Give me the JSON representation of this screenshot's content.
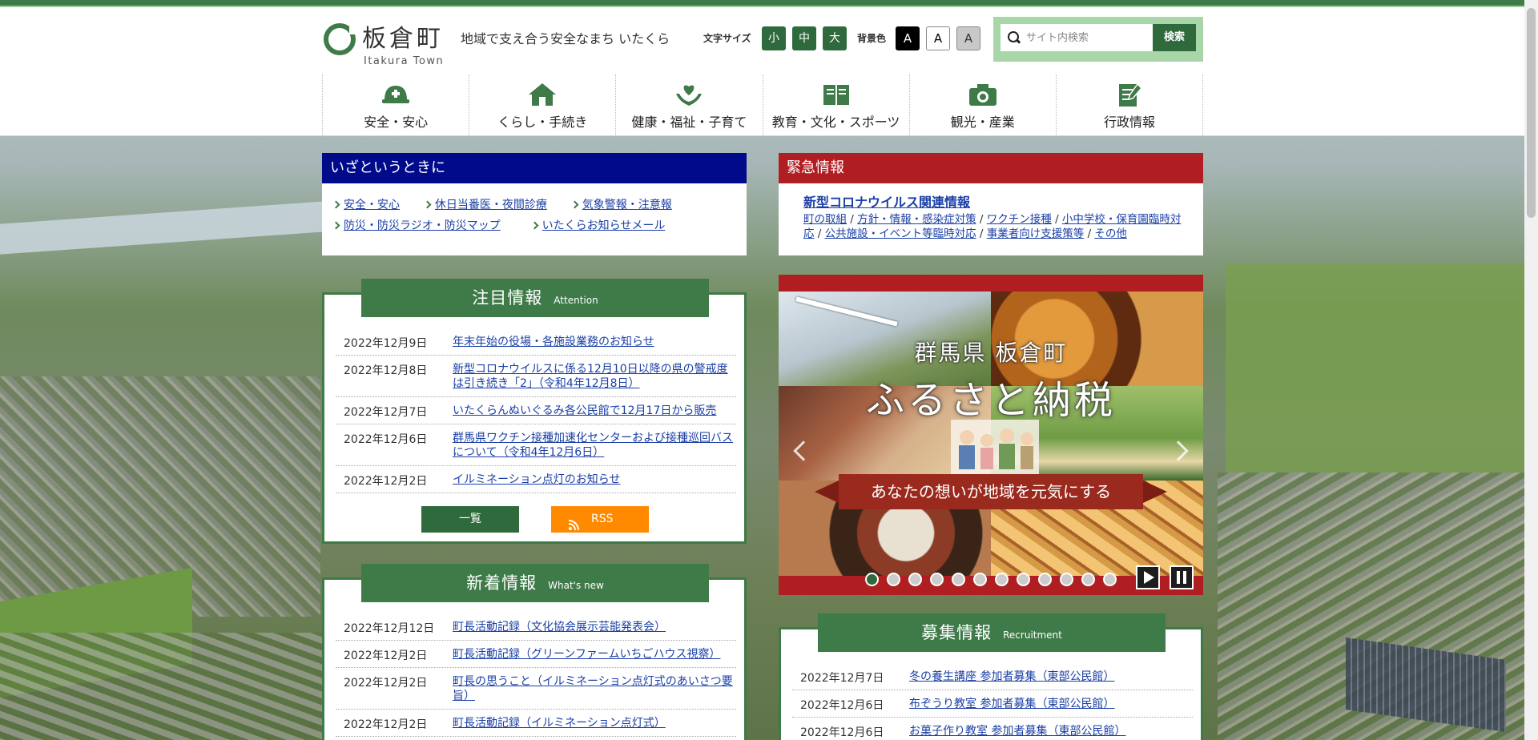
{
  "header": {
    "logo_ja": "板倉町",
    "logo_en": "Itakura Town",
    "tagline": "地域で支え合う安全なまち いたくら",
    "font_size_label": "文字サイズ",
    "font_size_options": [
      "小",
      "中",
      "大"
    ],
    "bg_label": "背景色",
    "bg_options": [
      "A",
      "A",
      "A"
    ],
    "search_placeholder": "サイト内検索",
    "search_button": "検索"
  },
  "nav": [
    {
      "label": "安全・安心",
      "icon": "helmet-icon"
    },
    {
      "label": "くらし・手続き",
      "icon": "house-icon"
    },
    {
      "label": "健康・福祉・子育て",
      "icon": "heart-hands-icon"
    },
    {
      "label": "教育・文化・スポーツ",
      "icon": "book-icon"
    },
    {
      "label": "観光・産業",
      "icon": "camera-icon"
    },
    {
      "label": "行政情報",
      "icon": "document-pen-icon"
    }
  ],
  "emergency_left": {
    "title": "いざというときに",
    "links": [
      "安全・安心",
      "休日当番医・夜間診療",
      "気象警報・注意報",
      "防災・防災ラジオ・防災マップ",
      "いたくらお知らせメール"
    ]
  },
  "emergency_right": {
    "title": "緊急情報",
    "headline": "新型コロナウイルス関連情報",
    "links": [
      "町の取組",
      "方針・情報・感染症対策",
      "ワクチン接種",
      "小中学校・保育園臨時対応",
      "公共施設・イベント等臨時対応",
      "事業者向け支援策等",
      "その他"
    ]
  },
  "attention": {
    "title": "注目情報",
    "title_en": "Attention",
    "items": [
      {
        "date": "2022年12月9日",
        "title": "年末年始の役場・各施設業務のお知らせ"
      },
      {
        "date": "2022年12月8日",
        "title": "新型コロナウイルスに係る12月10日以降の県の警戒度は引き続き「2」（令和4年12月8日）"
      },
      {
        "date": "2022年12月7日",
        "title": "いたくらんぬいぐるみ各公民館で12月17日から販売"
      },
      {
        "date": "2022年12月6日",
        "title": "群馬県ワクチン接種加速化センターおよび接種巡回バスについて（令和4年12月6日）"
      },
      {
        "date": "2022年12月2日",
        "title": "イルミネーション点灯のお知らせ"
      }
    ],
    "list_button": "一覧",
    "rss_button": "RSS"
  },
  "whats_new": {
    "title": "新着情報",
    "title_en": "What's new",
    "items": [
      {
        "date": "2022年12月12日",
        "title": "町長活動記録（文化協会展示芸能発表会）"
      },
      {
        "date": "2022年12月2日",
        "title": "町長活動記録（グリーンファームいちごハウス視察）"
      },
      {
        "date": "2022年12月2日",
        "title": "町長の思うこと（イルミネーション点灯式のあいさつ要旨）"
      },
      {
        "date": "2022年12月2日",
        "title": "町長活動記録（イルミネーション点灯式）"
      }
    ]
  },
  "carousel": {
    "line1": "群馬県 板倉町",
    "line2": "ふるさと納税",
    "banner": "あなたの想いが地域を元気にする",
    "dot_count": 12,
    "active_dot": 0
  },
  "recruit": {
    "title": "募集情報",
    "title_en": "Recruitment",
    "items": [
      {
        "date": "2022年12月7日",
        "title": "冬の養生講座 参加者募集（東部公民館）"
      },
      {
        "date": "2022年12月6日",
        "title": "布ぞうり教室 参加者募集（東部公民館）"
      },
      {
        "date": "2022年12月6日",
        "title": "お菓子作り教室 参加者募集（東部公民館）"
      }
    ]
  },
  "colors": {
    "brand_green": "#3f7a49",
    "emergency_blue": "#000a8a",
    "emergency_red": "#b01e22",
    "rss_orange": "#ff8a00"
  }
}
